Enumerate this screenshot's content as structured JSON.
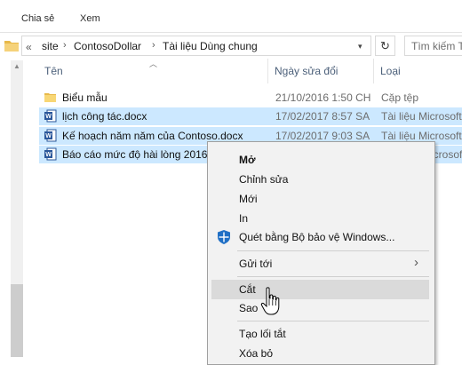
{
  "ribbon": {
    "tabs": [
      {
        "label": "Chia sẻ"
      },
      {
        "label": "Xem"
      }
    ]
  },
  "address": {
    "overflow": "«",
    "breadcrumbs": [
      "site",
      "ContosoDollar",
      "Tài liệu Dùng chung"
    ],
    "search_placeholder": "Tìm kiếm T"
  },
  "columns": {
    "name": "Tên",
    "date": "Ngày sửa đổi",
    "type": "Loại"
  },
  "files": [
    {
      "name": "Biểu mẫu",
      "date": "21/10/2016 1:50 CH",
      "type": "Cặp tệp",
      "icon": "folder-icon",
      "selected": false
    },
    {
      "name": "lịch công tác.docx",
      "date": "17/02/2017 8:57 SA",
      "type": "Tài liệu Microsoft",
      "icon": "word-doc-icon",
      "selected": true
    },
    {
      "name": "Kế hoạch năm năm của Contoso.docx",
      "date": "17/02/2017 9:03 SA",
      "type": "Tài liệu Microsoft",
      "icon": "word-doc-icon",
      "selected": true
    },
    {
      "name": "Báo cáo mức độ hài lòng 2016.d",
      "date": "",
      "type": "Microsoft",
      "icon": "word-doc-icon",
      "selected": true
    }
  ],
  "context_menu": {
    "open": "Mở",
    "edit": "Chỉnh sửa",
    "new": "Mới",
    "print": "In",
    "scan": "Quét bằng Bộ bảo vệ Windows...",
    "send_to": "Gửi tới",
    "cut": "Cắt",
    "copy": "Sao",
    "shortcut": "Tạo lối tắt",
    "delete": "Xóa bỏ"
  },
  "colors": {
    "selection": "#cce8ff",
    "menu_bg": "#f2f2f2",
    "menu_highlight": "#dadada",
    "header_text": "#4c607a"
  }
}
